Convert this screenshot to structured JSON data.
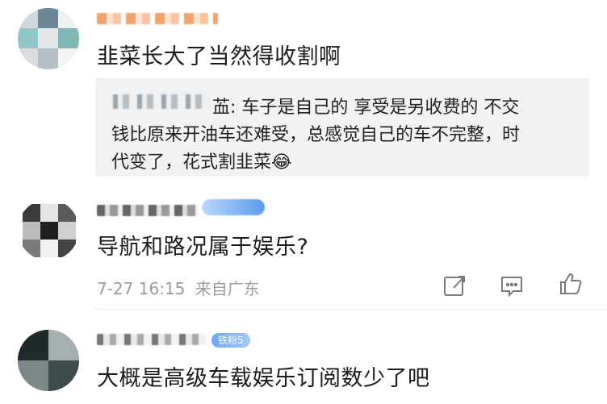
{
  "comments": [
    {
      "text": "韭菜长大了当然得收割啊",
      "quote": {
        "line1": "车子是自己的 享受是另收费的 不交",
        "line2": "钱比原来开油车还难受，总感觉自己的车不完整，时",
        "line3": "代变了，花式割韭菜"
      }
    },
    {
      "text": "导航和路况属于娱乐?",
      "time": "7-27 16:15",
      "location": "来自广东"
    },
    {
      "text": "大概是高级车载娱乐订阅数少了吧",
      "badge": "铁粉5"
    }
  ],
  "quote_prefix": "䒸: ",
  "emoji": "😂",
  "icons": [
    "share-icon",
    "comment-icon",
    "like-icon"
  ]
}
